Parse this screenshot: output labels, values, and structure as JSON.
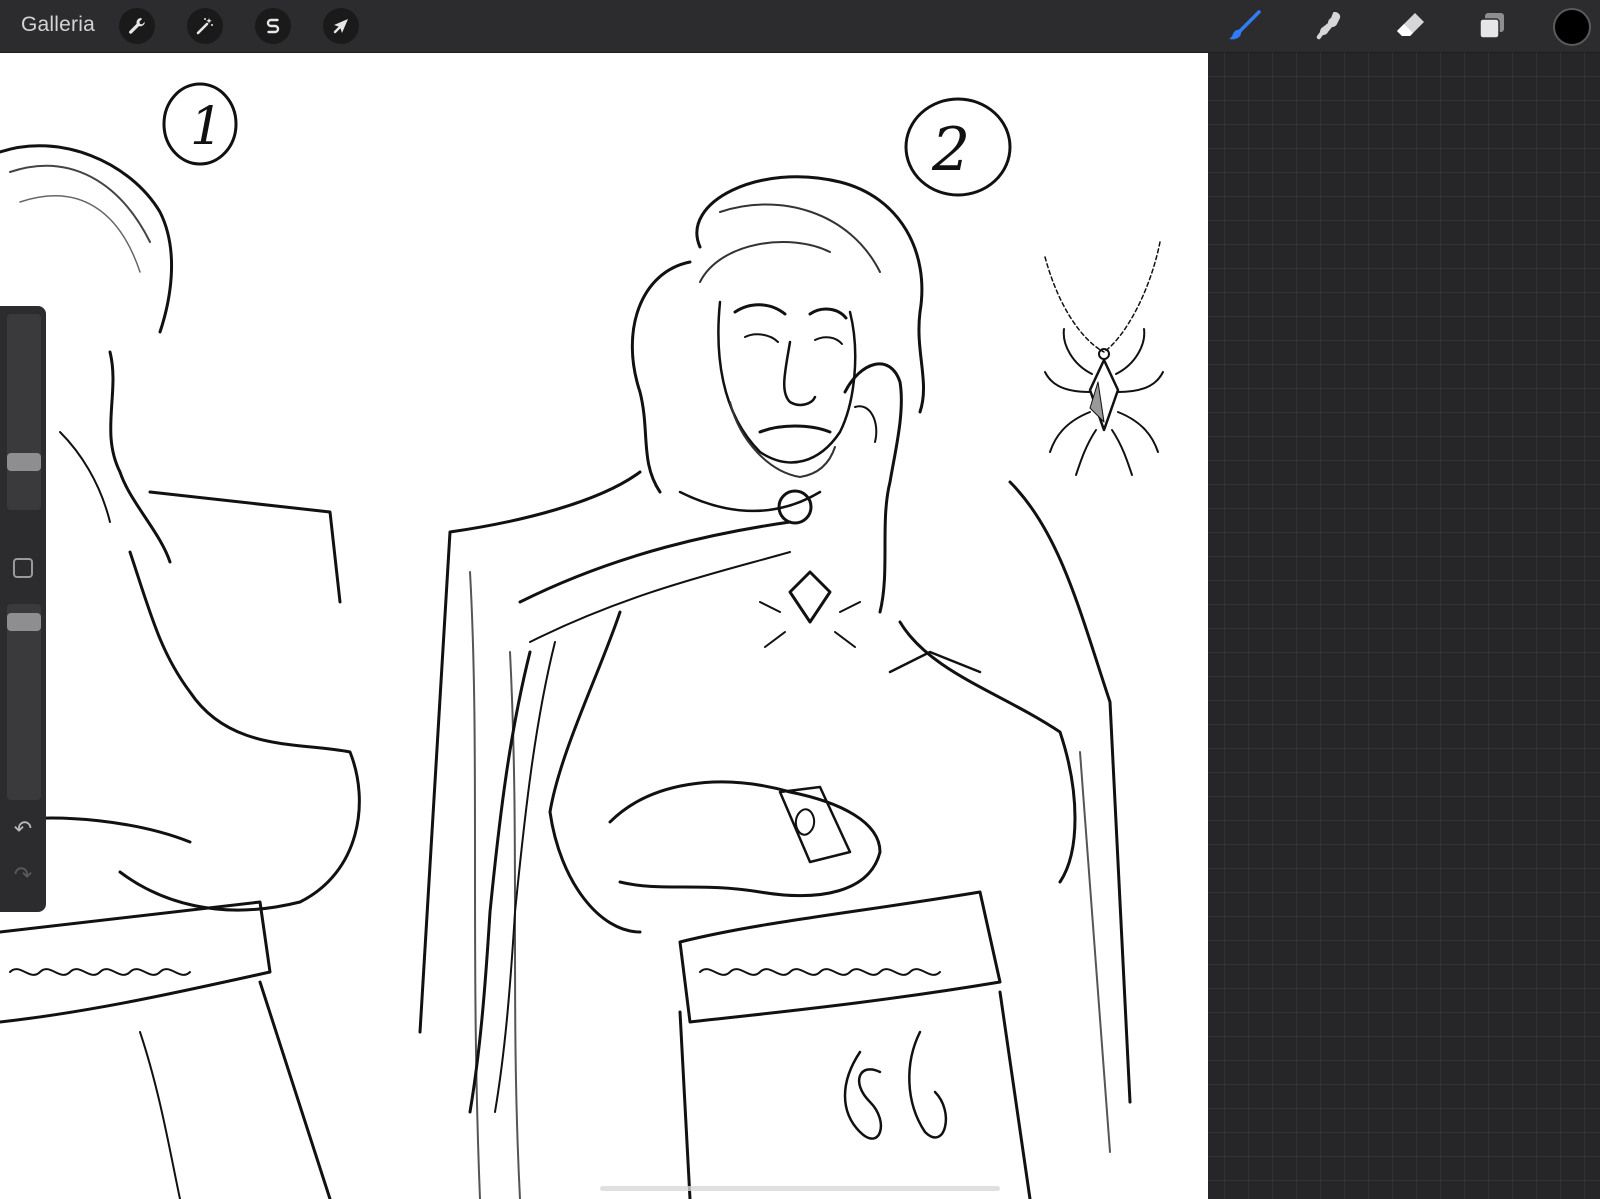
{
  "topbar": {
    "gallery_label": "Galleria",
    "left_tools": [
      {
        "name": "actions",
        "icon": "wrench-icon"
      },
      {
        "name": "adjustments",
        "icon": "magic-wand-icon"
      },
      {
        "name": "selection",
        "icon": "selection-s-icon"
      },
      {
        "name": "transform",
        "icon": "arrow-cursor-icon"
      }
    ],
    "right_tools": [
      {
        "name": "brush",
        "icon": "brush-icon",
        "active": true,
        "active_color": "#2f7cf6"
      },
      {
        "name": "smudge",
        "icon": "smudge-icon"
      },
      {
        "name": "eraser",
        "icon": "eraser-icon"
      },
      {
        "name": "layers",
        "icon": "layers-icon"
      }
    ],
    "current_color": "#000000"
  },
  "sidebar": {
    "brush_size_level": 0.22,
    "opacity_level": 0.95
  },
  "canvas": {
    "background": "#ffffff",
    "figure_labels": [
      "1",
      "2"
    ]
  }
}
